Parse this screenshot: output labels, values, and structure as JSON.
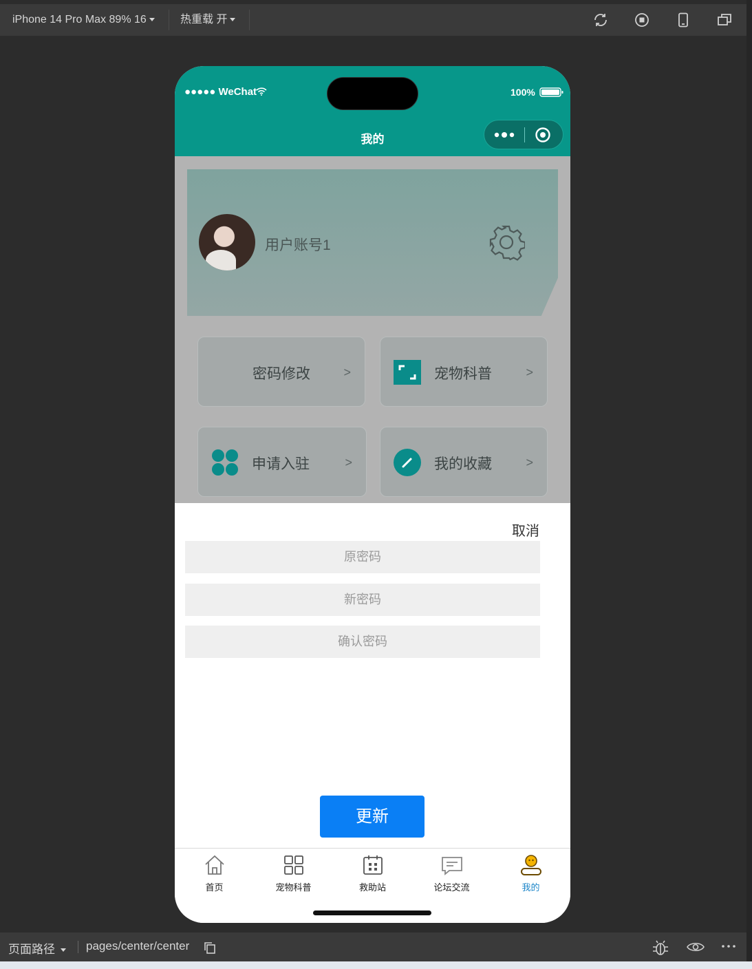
{
  "toolbar": {
    "device_label": "iPhone 14 Pro Max 89% 16",
    "hot_reload_label": "热重载 开",
    "icons": [
      "refresh-icon",
      "stop-icon",
      "phone-icon",
      "window-icon"
    ]
  },
  "status_bar": {
    "carrier": "●●●●● WeChat",
    "battery": "100%"
  },
  "navbar": {
    "title": "我的"
  },
  "profile": {
    "username": "用户账号1"
  },
  "menu": [
    {
      "label": "密码修改",
      "arrow": ">",
      "icon": "none"
    },
    {
      "label": "宠物科普",
      "arrow": ">",
      "icon": "frame-icon"
    },
    {
      "label": "申请入驻",
      "arrow": ">",
      "icon": "grid-dots-icon"
    },
    {
      "label": "我的收藏",
      "arrow": ">",
      "icon": "pencil-icon"
    }
  ],
  "sheet": {
    "cancel_label": "取消",
    "old_password_placeholder": "原密码",
    "new_password_placeholder": "新密码",
    "confirm_password_placeholder": "确认密码",
    "update_label": "更新"
  },
  "tabbar": [
    {
      "label": "首页",
      "icon": "home-icon"
    },
    {
      "label": "宠物科普",
      "icon": "grid-icon"
    },
    {
      "label": "救助站",
      "icon": "calendar-icon"
    },
    {
      "label": "论坛交流",
      "icon": "chat-icon"
    },
    {
      "label": "我的",
      "icon": "user-icon",
      "active": true
    }
  ],
  "bottom_bar": {
    "path_label": "页面路径",
    "path": "pages/center/center"
  },
  "colors": {
    "theme": "#07978a",
    "primary_button": "#0a7ff5",
    "active_tab": "#1d86c9"
  }
}
